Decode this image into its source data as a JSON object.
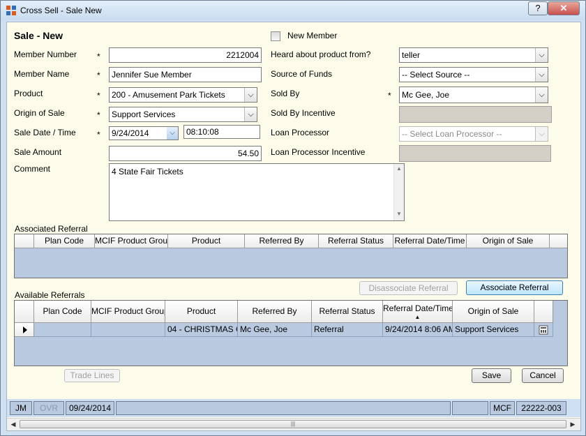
{
  "window": {
    "title": "Cross Sell - Sale New",
    "help_label": "?",
    "close_label": "✕"
  },
  "form": {
    "heading": "Sale - New",
    "new_member_label": "New Member",
    "required_mark": "*",
    "labels": {
      "member_number": "Member Number",
      "member_name": "Member Name",
      "product": "Product",
      "origin_of_sale": "Origin of Sale",
      "sale_date_time": "Sale Date / Time",
      "sale_amount": "Sale Amount",
      "comment": "Comment",
      "heard_about": "Heard about product from?",
      "source_of_funds": "Source of Funds",
      "sold_by": "Sold By",
      "sold_by_incentive": "Sold By Incentive",
      "loan_processor": "Loan Processor",
      "loan_processor_incentive": "Loan Processor Incentive"
    },
    "values": {
      "member_number": "2212004",
      "member_name": "Jennifer Sue Member",
      "product": "200 - Amusement Park Tickets",
      "origin_of_sale": "Support Services",
      "sale_date": "9/24/2014",
      "sale_time": "08:10:08",
      "sale_amount": "54.50",
      "comment": "4 State Fair Tickets",
      "heard_about": "teller",
      "source_of_funds": "-- Select Source --",
      "sold_by": "Mc Gee, Joe",
      "loan_processor": "-- Select Loan Processor --"
    }
  },
  "associated_referral": {
    "title": "Associated Referral",
    "columns": [
      "Plan Code",
      "MCIF Product Group",
      "Product",
      "Referred By",
      "Referral Status",
      "Referral Date/Time",
      "Origin of Sale"
    ],
    "disassociate_label": "Disassociate Referral",
    "associate_label": "Associate Referral"
  },
  "available_referrals": {
    "title": "Available Referrals",
    "columns": [
      "Plan Code",
      "MCIF Product Group",
      "Product",
      "Referred By",
      "Referral Status",
      "Referral Date/Time",
      "Origin of Sale"
    ],
    "sort_indicator": "▲",
    "rows": [
      {
        "plan_code": "",
        "mcif_group": "",
        "product": "04 - CHRISTMAS C",
        "referred_by": "Mc Gee, Joe",
        "status": "Referral",
        "date_time": "9/24/2014 8:06 AM",
        "origin": "Support Services"
      }
    ]
  },
  "buttons": {
    "trade_lines": "Trade Lines",
    "save": "Save",
    "cancel": "Cancel"
  },
  "status_bar": {
    "user": "JM",
    "ovr": "OVR",
    "date": "09/24/2014",
    "system": "MCF",
    "code": "22222-003"
  }
}
